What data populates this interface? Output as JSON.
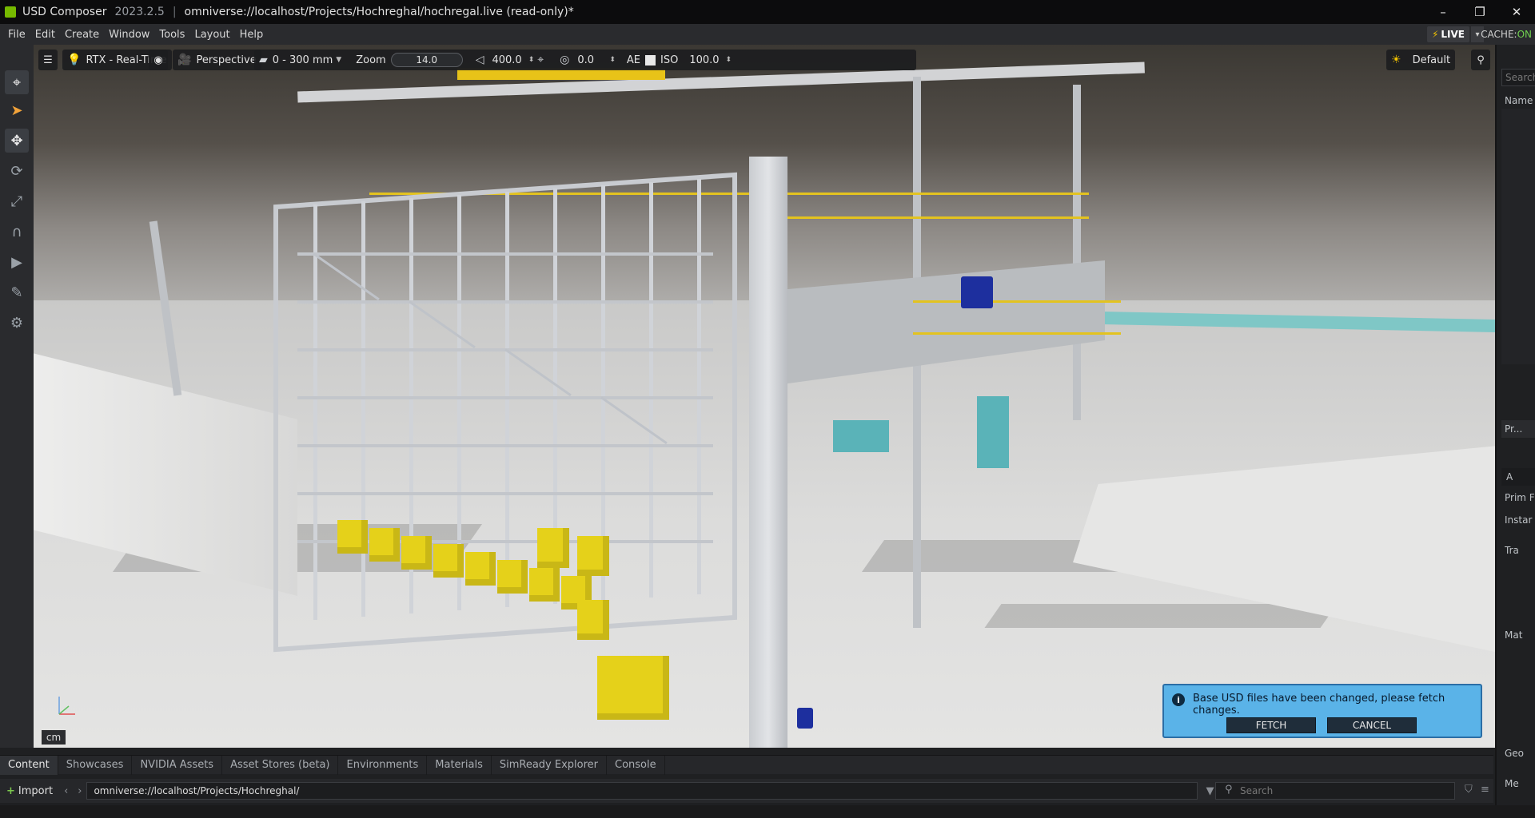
{
  "titlebar": {
    "app_name": "USD Composer",
    "version": "2023.2.5",
    "file_path": "omniverse://localhost/Projects/Hochreghal/hochregal.live (read-only)*",
    "minimize": "–",
    "maximize": "❐",
    "close": "✕"
  },
  "menu": [
    "File",
    "Edit",
    "Create",
    "Window",
    "Tools",
    "Layout",
    "Help"
  ],
  "live": {
    "label": "LIVE",
    "cache_label": "CACHE:",
    "cache_state": "ON"
  },
  "viewport_toolbar": {
    "renderer": "RTX - Real-Time",
    "camera": "Perspective",
    "lens": "0 - 300 mm",
    "zoom_label": "Zoom",
    "zoom_value": "14.0",
    "focus_value": "400.0",
    "fstop_value": "0.0",
    "ae_label": "AE",
    "iso_label": "ISO",
    "iso_value": "100.0",
    "lighting": "Default"
  },
  "viewport": {
    "unit": "cm"
  },
  "notification": {
    "message": "Base USD files have been changed, please fetch changes.",
    "fetch": "FETCH",
    "cancel": "CANCEL"
  },
  "right_panel": {
    "search": "Search",
    "name_header": "Name",
    "props_tab": "Pr...",
    "add": "A",
    "prim": "Prim F",
    "instance": "Instar",
    "transform": "Tra",
    "material": "Mat",
    "geometry": "Geo",
    "me": "Me"
  },
  "bottom_tabs": [
    "Content",
    "Showcases",
    "NVIDIA Assets",
    "Asset Stores (beta)",
    "Environments",
    "Materials",
    "SimReady Explorer",
    "Console"
  ],
  "content": {
    "import": "Import",
    "path": "omniverse://localhost/Projects/Hochreghal/",
    "search_placeholder": "Search"
  }
}
